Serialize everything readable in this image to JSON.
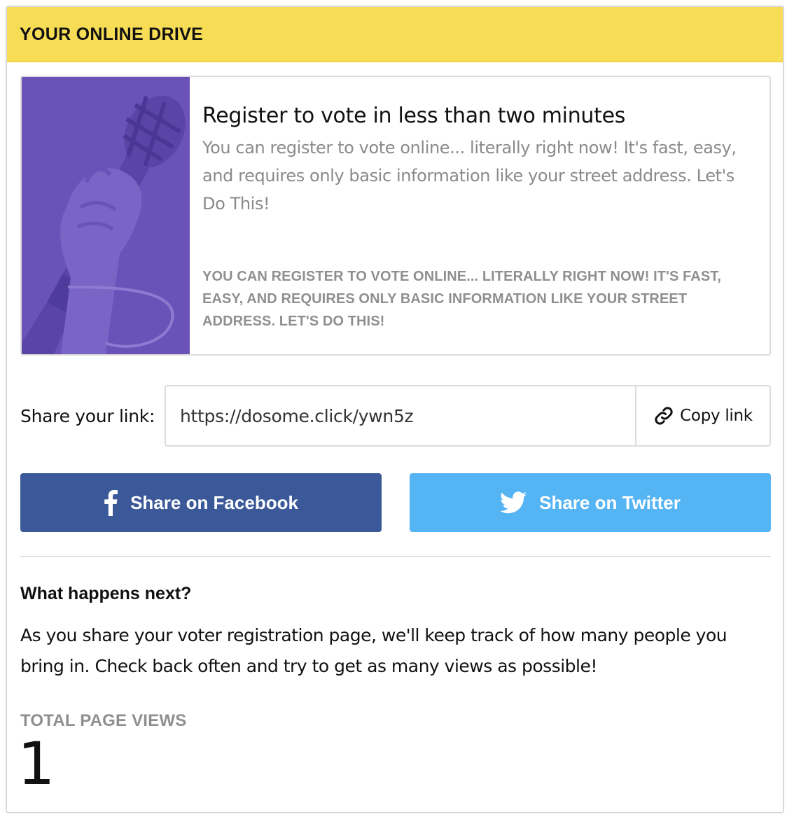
{
  "header": {
    "title": "YOUR ONLINE DRIVE"
  },
  "promo": {
    "image_icon": "hand-microphone-illustration",
    "title": "Register to vote in less than two minutes",
    "description": "You can register to vote online... literally right now! It's fast, easy, and requires only basic information like your street address. Let's Do This!",
    "caps_description": "You can register to vote online... literally right now! It's fast, easy, and requires only basic information like your street address. Let's Do This!",
    "image_color": "#6a52b9"
  },
  "share": {
    "label": "Share your link:",
    "link_value": "https://dosome.click/ywn5z",
    "copy_label": "Copy link",
    "copy_icon": "link-icon"
  },
  "social": {
    "facebook_label": "Share on Facebook",
    "facebook_icon": "facebook-icon",
    "facebook_color": "#3b5998",
    "twitter_label": "Share on Twitter",
    "twitter_icon": "twitter-icon",
    "twitter_color": "#55b4f3"
  },
  "next": {
    "title": "What happens next?",
    "description": "As you share your voter registration page, we'll keep track of how many people you bring in. Check back often and try to get as many views as possible!"
  },
  "views": {
    "label": "TOTAL PAGE VIEWS",
    "count": "1"
  },
  "colors": {
    "header_bg": "#f7dc55"
  }
}
